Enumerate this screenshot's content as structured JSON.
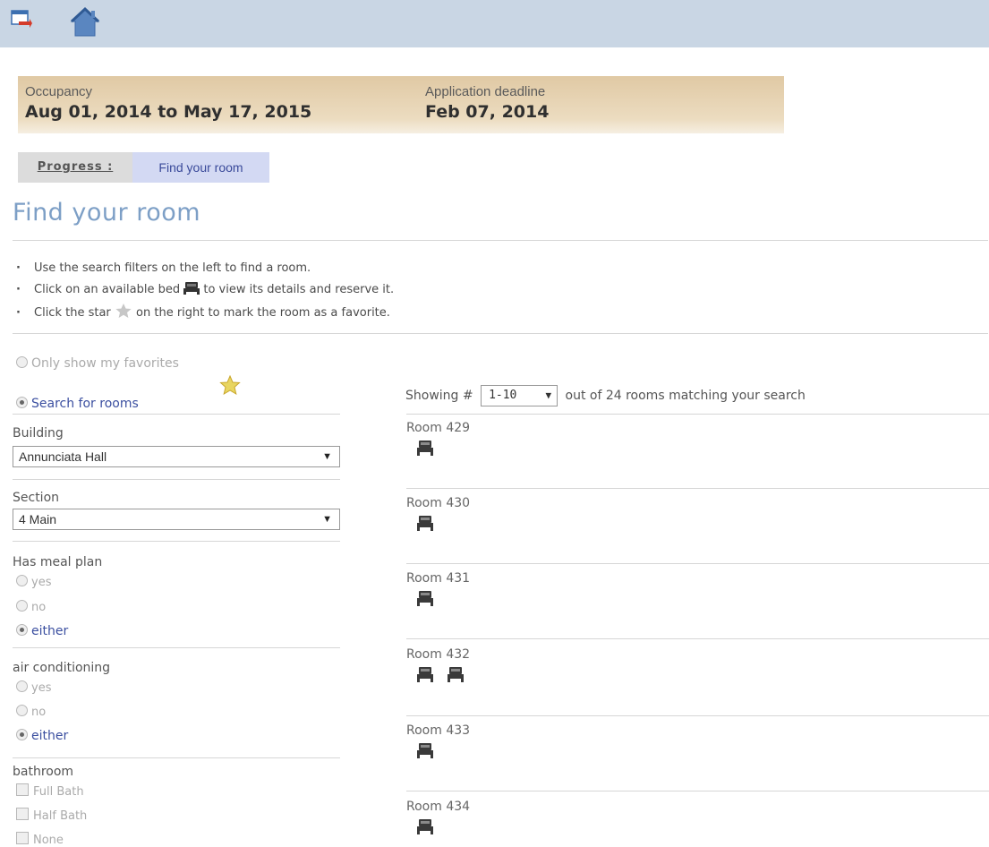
{
  "toolbar": {
    "exit_icon": "exit-icon",
    "home_icon": "home-icon"
  },
  "occupancy": {
    "occupancy_label": "Occupancy",
    "occupancy_value": "Aug 01, 2014 to May 17, 2015",
    "deadline_label": "Application deadline",
    "deadline_value": "Feb 07, 2014"
  },
  "progress": {
    "label": "Progress :",
    "step": "Find your room"
  },
  "page": {
    "title": "Find your room",
    "instructions": {
      "i1": "Use the search filters on the left to find a room.",
      "i2_before": "Click on an available bed",
      "i2_after": "to view its details and reserve it.",
      "i3_before": "Click the star",
      "i3_after": "on the right to mark the room as a favorite."
    }
  },
  "filters": {
    "favorites_option": "Only show my favorites",
    "search_option": "Search for rooms",
    "building_label": "Building",
    "building_value": "Annunciata Hall",
    "section_label": "Section",
    "section_value": "4 Main",
    "meal_label": "Has meal plan",
    "ac_label": "air conditioning",
    "opt_yes": "yes",
    "opt_no": "no",
    "opt_either": "either",
    "bathroom_label": "bathroom",
    "bath_full": "Full Bath",
    "bath_half": "Half Bath",
    "bath_none": "None"
  },
  "results": {
    "showing_prefix": "Showing #",
    "page_range": "1-10",
    "showing_suffix": "out of 24 rooms matching your search",
    "rooms": [
      {
        "name": "Room 429",
        "beds": 1
      },
      {
        "name": "Room 430",
        "beds": 1
      },
      {
        "name": "Room 431",
        "beds": 1
      },
      {
        "name": "Room 432",
        "beds": 2
      },
      {
        "name": "Room 433",
        "beds": 1
      },
      {
        "name": "Room 434",
        "beds": 1
      }
    ]
  },
  "colors": {
    "accent": "#7d9fc6",
    "link": "#3b4fa0",
    "topbar": "#c9d6e4",
    "panel": "#e0c9a4"
  }
}
